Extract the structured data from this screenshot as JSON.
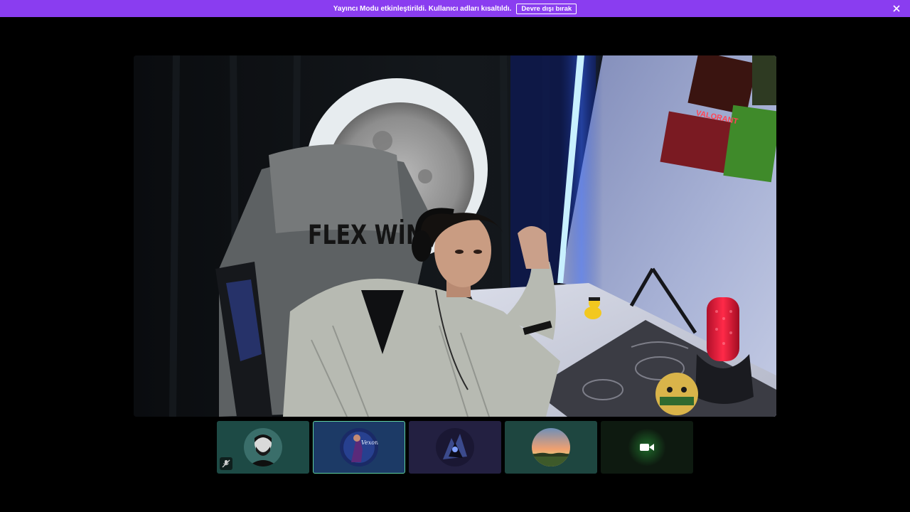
{
  "banner": {
    "message": "Yayıncı Modu etkinleştirildi. Kullanıcı adları kısaltıldı.",
    "disable_label": "Devre dışı bırak",
    "background": "#8a3df0"
  },
  "main_stream": {
    "chair_text": "FLEX WİN",
    "poster_text": "VALORANT"
  },
  "participants": [
    {
      "avatar": "bearded-man-avatar",
      "muted": true,
      "tile_color": "#1d4a45"
    },
    {
      "avatar": "valorant-character-avatar",
      "avatar_text": "Vexon",
      "selected": true,
      "tile_color": "#1c3a66"
    },
    {
      "avatar": "dark-character-avatar",
      "tile_color": "#232041"
    },
    {
      "avatar": "sunset-landscape-avatar",
      "tile_color": "#1e4640"
    },
    {
      "avatar": "video-camera-icon",
      "camera_on": true,
      "tile_color": "#0e1a10"
    }
  ]
}
